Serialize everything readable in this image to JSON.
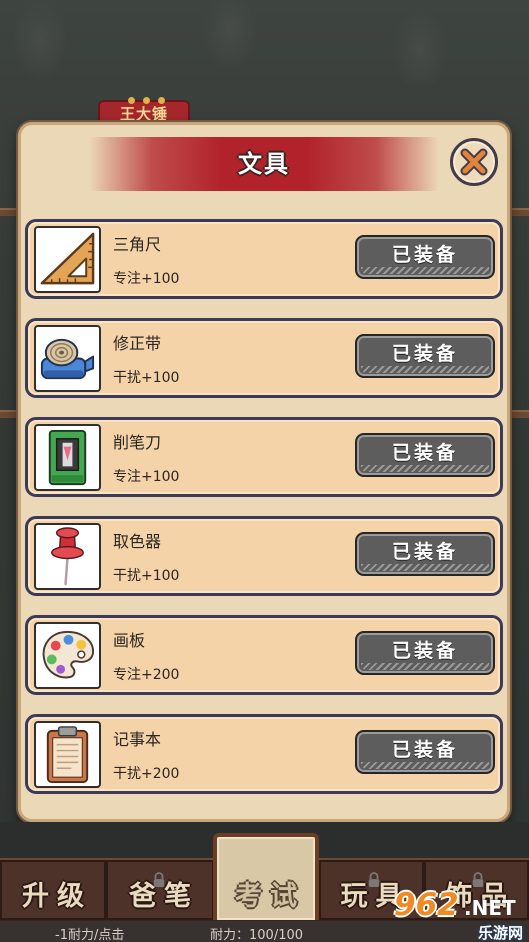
{
  "background": {
    "character_name": "王大锤"
  },
  "dialog": {
    "title": "文具",
    "close_icon": "close-icon",
    "items": [
      {
        "name": "三角尺",
        "stat": "专注+100",
        "button_label": "已装备",
        "icon": "triangle-ruler-icon"
      },
      {
        "name": "修正带",
        "stat": "干扰+100",
        "button_label": "已装备",
        "icon": "correction-tape-icon"
      },
      {
        "name": "削笔刀",
        "stat": "专注+100",
        "button_label": "已装备",
        "icon": "pencil-sharpener-icon"
      },
      {
        "name": "取色器",
        "stat": "干扰+100",
        "button_label": "已装备",
        "icon": "pushpin-icon"
      },
      {
        "name": "画板",
        "stat": "专注+200",
        "button_label": "已装备",
        "icon": "palette-icon"
      },
      {
        "name": "记事本",
        "stat": "干扰+200",
        "button_label": "已装备",
        "icon": "clipboard-icon"
      }
    ]
  },
  "bottom_tabs": [
    {
      "label": "升级",
      "locked": false,
      "selected": false
    },
    {
      "label": "爸笔",
      "locked": true,
      "selected": false
    },
    {
      "label": "考试",
      "locked": false,
      "selected": true
    },
    {
      "label": "玩具",
      "locked": true,
      "selected": false
    },
    {
      "label": "饰品",
      "locked": true,
      "selected": false
    }
  ],
  "status_bar": {
    "click_cost": "-1耐力/点击",
    "stamina": "耐力：100/100"
  },
  "watermark": {
    "brand_number": "962",
    "brand_suffix": ".NET",
    "site_name": "乐游网"
  },
  "colors": {
    "title_banner": "#b1222a",
    "card_fill": "#f4d3a8",
    "card_border": "#3c3a56",
    "equip_button": "#5d5d5d",
    "close_x": "#e3843a"
  }
}
